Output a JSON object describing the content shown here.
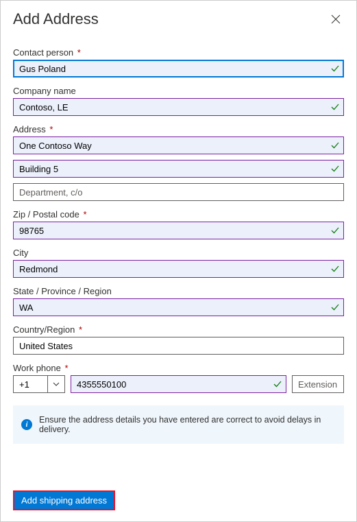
{
  "header": {
    "title": "Add Address"
  },
  "fields": {
    "contact_person": {
      "label": "Contact person",
      "value": "Gus Poland",
      "required": true
    },
    "company_name": {
      "label": "Company name",
      "value": "Contoso, LE",
      "required": false
    },
    "address": {
      "label": "Address",
      "line1": "One Contoso Way",
      "line2": "Building 5",
      "line3_placeholder": "Department, c/o",
      "required": true
    },
    "zip": {
      "label": "Zip / Postal code",
      "value": "98765",
      "required": true
    },
    "city": {
      "label": "City",
      "value": "Redmond",
      "required": false
    },
    "state": {
      "label": "State / Province / Region",
      "value": "WA",
      "required": false
    },
    "country": {
      "label": "Country/Region",
      "value": "United States",
      "required": true
    },
    "phone": {
      "label": "Work phone",
      "cc": "+1",
      "number": "4355550100",
      "ext_placeholder": "Extension",
      "required": true
    }
  },
  "info": {
    "text": "Ensure the address details you have entered are correct to avoid delays in delivery."
  },
  "actions": {
    "submit": "Add shipping address"
  }
}
